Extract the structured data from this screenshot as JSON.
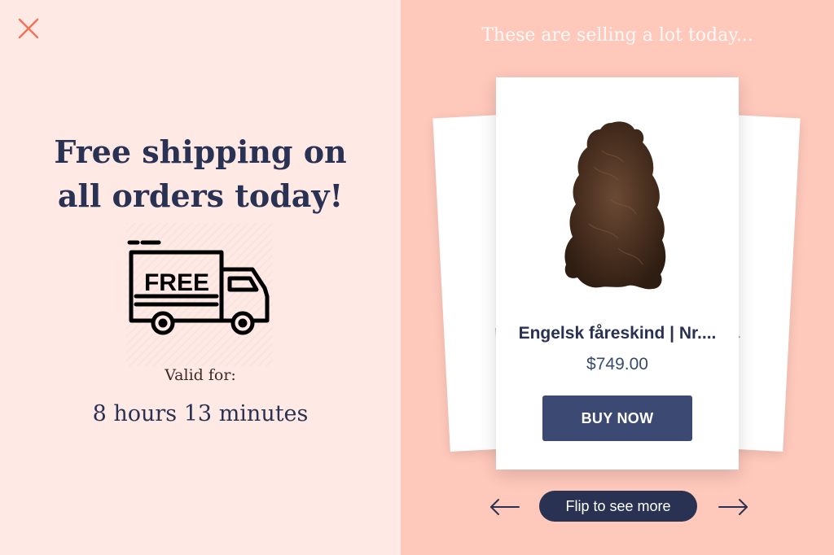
{
  "colors": {
    "left_bg": "#ffe9e5",
    "right_bg": "#fec8bb",
    "accent_close": "#f2735a",
    "navy": "#2a3253",
    "button": "#3c4a73"
  },
  "left": {
    "close_icon": "close-icon",
    "headline": "Free shipping on\nall orders today!",
    "truck_icon": "free-delivery-truck-icon",
    "truck_text": "FREE",
    "valid_label": "Valid for:",
    "valid_time": "8 hours 13 minutes"
  },
  "right": {
    "title": "These are selling a lot today...",
    "back_left_peek": "H",
    "back_right_peek": "o...",
    "product": {
      "image": "sheepskin-rug-image",
      "name": "Engelsk fåreskind | Nr....",
      "price": "$749.00",
      "buy_label": "BUY NOW"
    },
    "prev_icon": "arrow-left-icon",
    "next_icon": "arrow-right-icon",
    "flip_label": "Flip to see more"
  }
}
